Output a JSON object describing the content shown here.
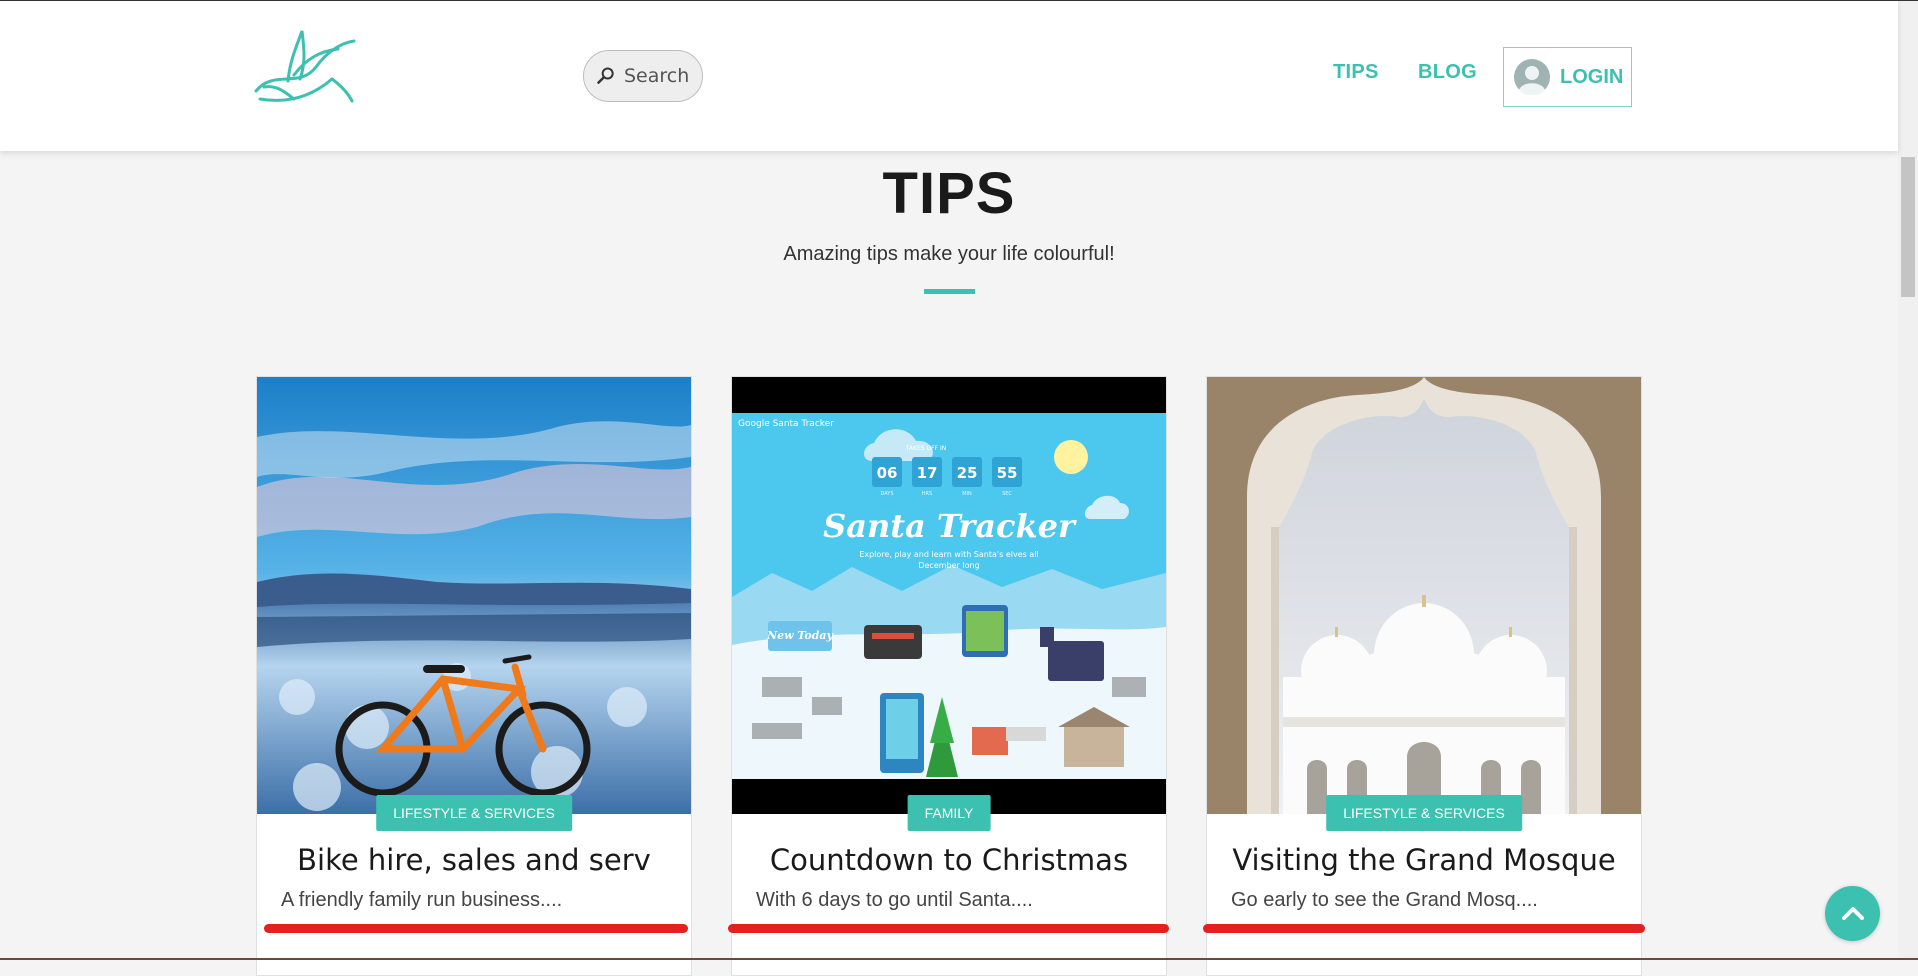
{
  "header": {
    "search_placeholder": "Search",
    "nav": {
      "tips": "TIPS",
      "blog": "BLOG",
      "login": "LOGIN"
    }
  },
  "section": {
    "title": "TIPS",
    "subtitle": "Amazing tips make your life colourful!"
  },
  "cards": [
    {
      "category": "LIFESTYLE & SERVICES",
      "title": "Bike hire, sales and serv",
      "excerpt": "A friendly family run business...."
    },
    {
      "category": "FAMILY",
      "title": "Countdown to Christmas",
      "excerpt": "With 6 days to go until Santa...."
    },
    {
      "category": "LIFESTYLE & SERVICES",
      "title": "Visiting the Grand Mosque",
      "excerpt": "Go early to see the Grand Mosq...."
    }
  ],
  "santa_tracker": {
    "brand": "Google Santa Tracker",
    "takes_off": "TAKES OFF IN",
    "countdown": [
      "06",
      "17",
      "25",
      "55"
    ],
    "countdown_units": [
      "DAYS",
      "HRS",
      "MIN",
      "SEC"
    ],
    "heading": "Santa Tracker",
    "tagline_1": "Explore, play and learn with Santa's elves all",
    "tagline_2": "December long",
    "new_today": "New Today"
  },
  "colors": {
    "accent": "#3cc0b0",
    "highlight": "#e3221f"
  },
  "icons": {
    "logo": "swallow-bird-logo",
    "search": "magnifier-icon",
    "avatar": "user-avatar-icon",
    "back_to_top": "chevron-up-icon"
  }
}
